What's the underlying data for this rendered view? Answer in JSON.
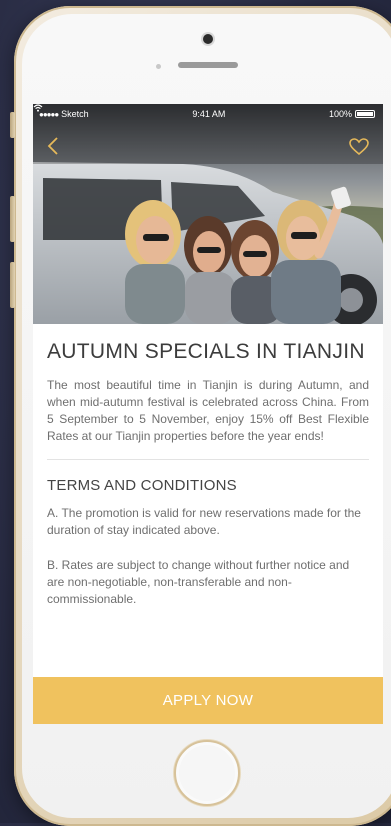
{
  "status_bar": {
    "carrier": "Sketch",
    "time": "9:41 AM",
    "battery": "100%"
  },
  "nav": {
    "back_icon": "chevron-left-icon",
    "favorite_icon": "heart-icon"
  },
  "article": {
    "title": "AUTUMN SPECIALS IN TIANJIN",
    "intro": "The most beautiful time in Tianjin is during Autumn, and when mid-autumn festival is celebrated across China. From 5 September to 5 November, enjoy 15% off Best Flexible Rates at our Tianjin properties before the year ends!",
    "terms_heading": "TERMS AND CONDITIONS",
    "terms": [
      "A. The promotion is valid for new reservations made for the duration of stay indicated above.",
      "B. Rates are subject to change without further notice and are non-negotiable, non-transferable and non-commissionable."
    ]
  },
  "cta": {
    "label": "APPLY NOW"
  },
  "colors": {
    "accent": "#f0c25e",
    "nav_icon": "#e6b95a",
    "heading_text": "#3c3c3c",
    "body_text": "#6f6f6f"
  }
}
